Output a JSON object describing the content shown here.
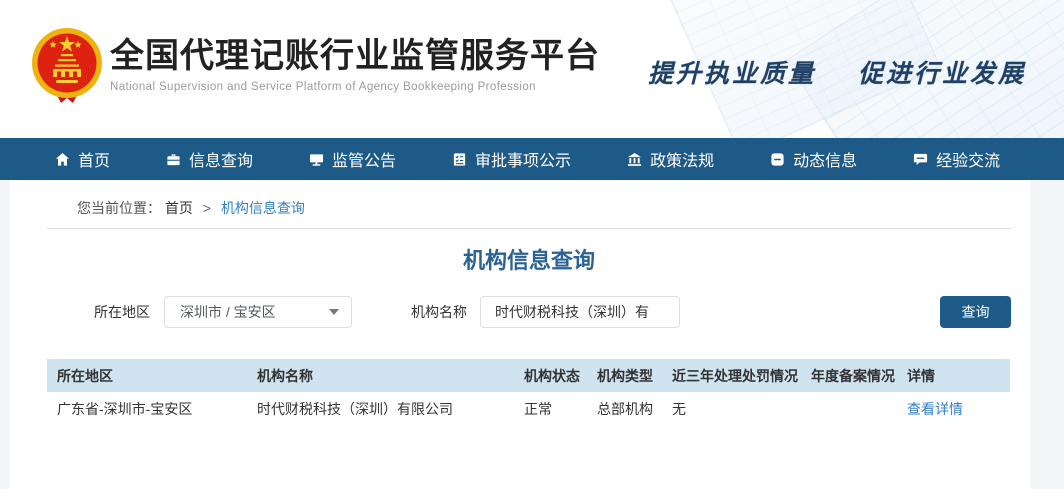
{
  "header": {
    "title": "全国代理记账行业监管服务平台",
    "subtitle": "National Supervision and Service Platform of Agency Bookkeeping  Profession",
    "slogan_left": "提升执业质量",
    "slogan_right": "促进行业发展",
    "logo": "prc-national-emblem"
  },
  "nav": {
    "items": [
      {
        "label": "首页",
        "icon": "home-icon"
      },
      {
        "label": "信息查询",
        "icon": "briefcase-icon"
      },
      {
        "label": "监管公告",
        "icon": "monitor-icon"
      },
      {
        "label": "审批事项公示",
        "icon": "checklist-icon"
      },
      {
        "label": "政策法规",
        "icon": "bank-icon"
      },
      {
        "label": "动态信息",
        "icon": "minus-square-icon"
      },
      {
        "label": "经验交流",
        "icon": "chat-icon"
      }
    ]
  },
  "breadcrumb": {
    "prefix": "您当前位置：",
    "home": "首页",
    "separator": ">",
    "current": "机构信息查询"
  },
  "page": {
    "title": "机构信息查询"
  },
  "search": {
    "region_label": "所在地区",
    "region_value": "深圳市 / 宝安区",
    "name_label": "机构名称",
    "name_value": "时代财税科技（深圳）有",
    "submit_label": "查询"
  },
  "table": {
    "columns": [
      "所在地区",
      "机构名称",
      "机构状态",
      "机构类型",
      "近三年处理处罚情况",
      "年度备案情况",
      "详情"
    ],
    "rows": [
      {
        "region": "广东省-深圳市-宝安区",
        "name": "时代财税科技（深圳）有限公司",
        "status": "正常",
        "type": "总部机构",
        "penalty": "无",
        "filing": "",
        "detail": "查看详情"
      }
    ]
  },
  "colors": {
    "nav_bg": "#1e5a87",
    "accent_button": "#1e5a87",
    "link": "#3380c9",
    "table_header_bg": "#d0e3f1",
    "page_title": "#2b6294",
    "slogan": "#1f4166",
    "emblem_red": "#df2112",
    "emblem_gold": "#efb310"
  }
}
